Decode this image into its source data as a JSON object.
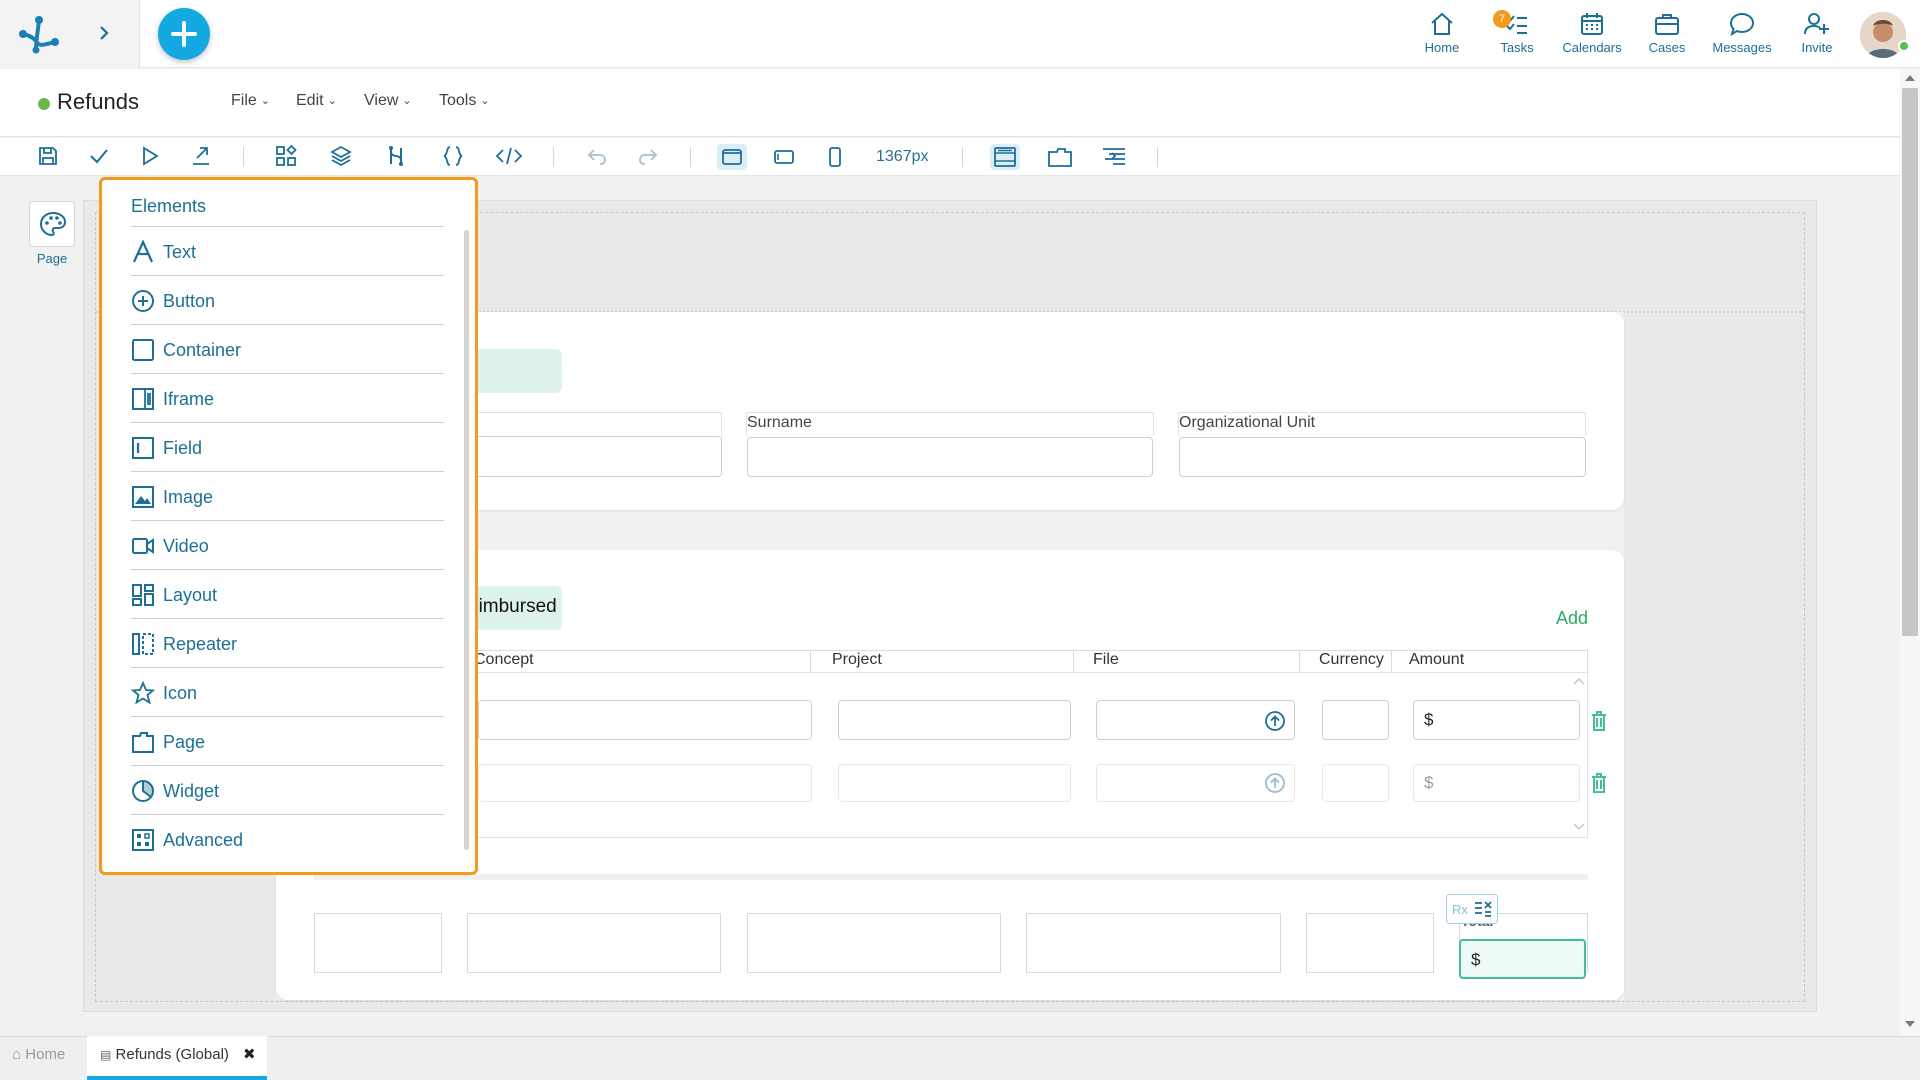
{
  "topbar": {
    "nav": [
      {
        "label": "Home",
        "icon": "home-icon"
      },
      {
        "label": "Tasks",
        "icon": "tasks-icon",
        "badge": "7"
      },
      {
        "label": "Calendars",
        "icon": "calendar-icon"
      },
      {
        "label": "Cases",
        "icon": "briefcase-icon"
      },
      {
        "label": "Messages",
        "icon": "chat-bubble-icon"
      },
      {
        "label": "Invite",
        "icon": "add-user-icon"
      }
    ],
    "accent": "#15a9e1"
  },
  "app": {
    "title": "Refunds",
    "menus": [
      "File",
      "Edit",
      "View",
      "Tools"
    ]
  },
  "toolbar": {
    "width_label": "1367px"
  },
  "side": {
    "page_tab_label": "Page"
  },
  "form": {
    "card1": {
      "labels": [
        "Surname",
        "Organizational Unit"
      ]
    },
    "card2": {
      "title": "eimbursed",
      "add_label": "Add",
      "columns": [
        "Concept",
        "Project",
        "File",
        "Currency",
        "Amount"
      ],
      "currency_symbol": "$"
    },
    "totals": {
      "label": "Total",
      "value": "$",
      "rx_label": "Rx"
    }
  },
  "elements_panel": {
    "title": "Elements",
    "items": [
      {
        "label": "Text",
        "icon": "text-icon"
      },
      {
        "label": "Button",
        "icon": "plus-circle-icon"
      },
      {
        "label": "Container",
        "icon": "container-icon"
      },
      {
        "label": "Iframe",
        "icon": "iframe-icon"
      },
      {
        "label": "Field",
        "icon": "field-icon"
      },
      {
        "label": "Image",
        "icon": "image-icon"
      },
      {
        "label": "Video",
        "icon": "video-icon"
      },
      {
        "label": "Layout",
        "icon": "layout-icon"
      },
      {
        "label": "Repeater",
        "icon": "repeater-icon"
      },
      {
        "label": "Icon",
        "icon": "star-icon"
      },
      {
        "label": "Page",
        "icon": "page-icon"
      },
      {
        "label": "Widget",
        "icon": "widget-icon"
      },
      {
        "label": "Advanced",
        "icon": "advanced-icon"
      }
    ],
    "highlight_color": "#f29b1c"
  },
  "bottom_tabs": {
    "home_label": "Home",
    "refunds_label": "Refunds (Global)"
  }
}
